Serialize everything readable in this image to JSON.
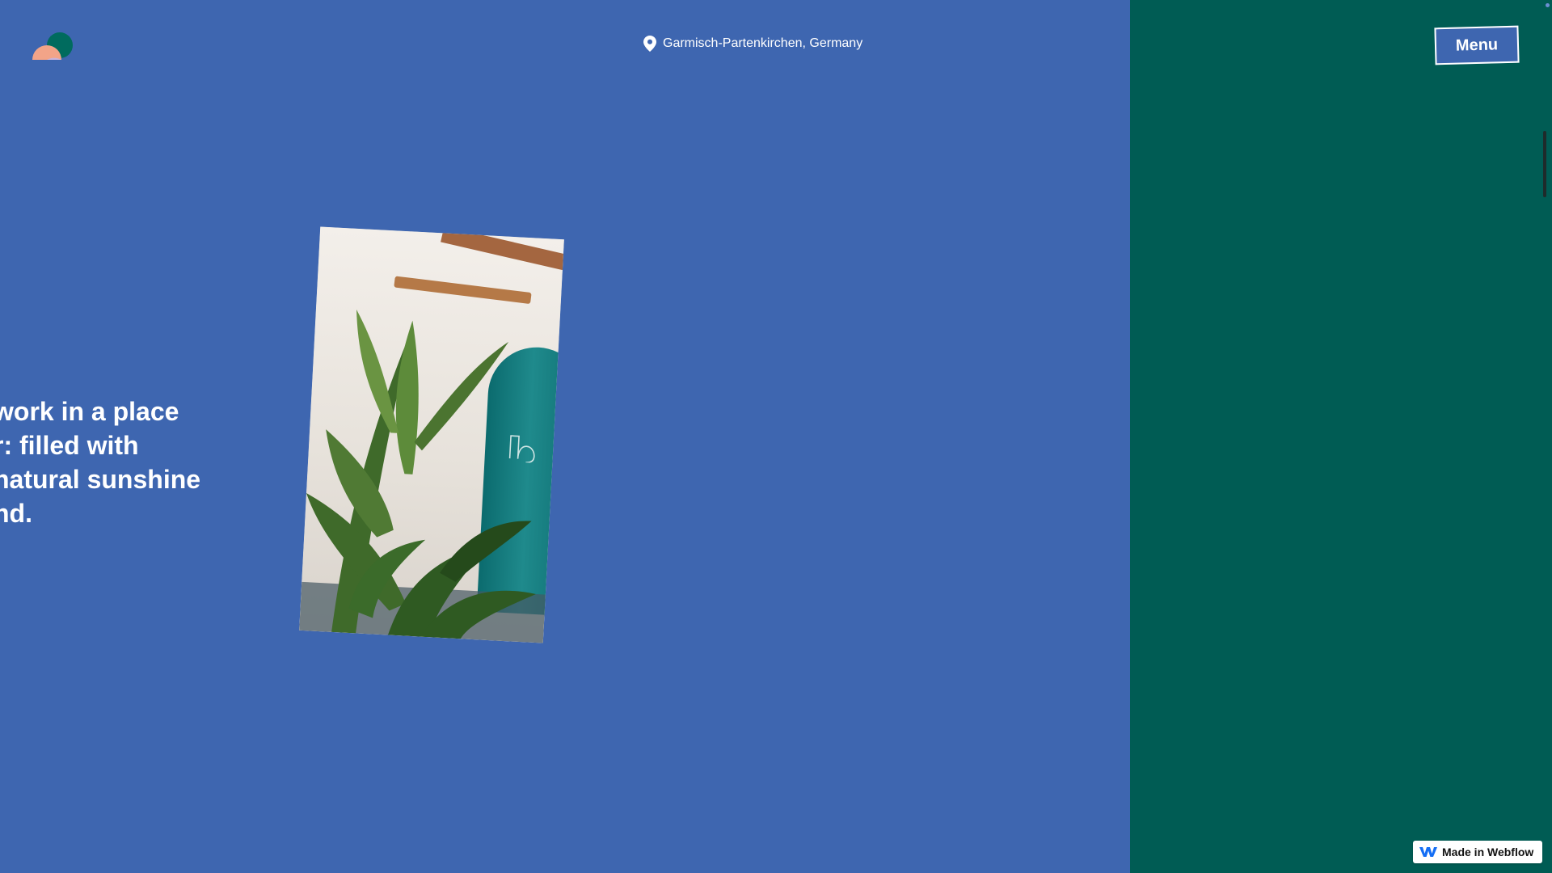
{
  "header": {
    "location": "Garmisch-Partenkirchen, Germany",
    "menu_label": "Menu"
  },
  "hero": {
    "text": "work in a place\nr: filled with\nnatural sunshine\nnd."
  },
  "footer": {
    "badge_label": "Made in Webflow"
  },
  "icons": {
    "logo": "brand-logo-icon",
    "location": "location-pin-icon",
    "webflow": "webflow-logo-icon"
  },
  "colors": {
    "blue_panel": "#3e66b0",
    "green_panel": "#005c54",
    "logo_peach": "#f2a488",
    "logo_lilac": "#c3b5e4",
    "logo_teal": "#006b5e",
    "webflow_blue": "#146ef5"
  }
}
